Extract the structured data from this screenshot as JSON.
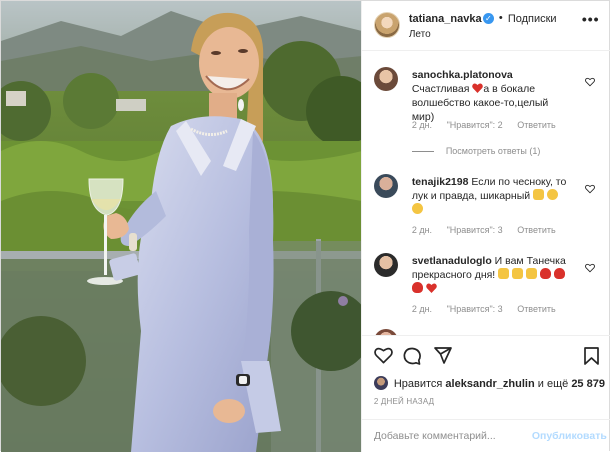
{
  "header": {
    "username": "tatiana_navka",
    "separator": "•",
    "follow_label": "Подписки",
    "location": "Лето",
    "more_label": "•••"
  },
  "comments": [
    {
      "username": "sanochka.platonova",
      "text_a": "Счастливая",
      "text_b": "а в бокале волшебство какое-то,целый мир)",
      "time": "2 дн.",
      "likes": "\"Нравится\": 2",
      "reply": "Ответить",
      "view_replies": "Посмотреть ответы (1)"
    },
    {
      "username": "tenajik2198",
      "text": "Если по чесноку, то лук и правда, шикарный",
      "time": "2 дн.",
      "likes": "\"Нравится\": 3",
      "reply": "Ответить"
    },
    {
      "username": "svetlanaduloglo",
      "text": "И вам Танечка прекрасного дня!",
      "time": "2 дн.",
      "likes": "\"Нравится\": 3",
      "reply": "Ответить"
    }
  ],
  "likes": {
    "prefix": "Нравится",
    "user": "aleksandr_zhulin",
    "middle": "и ещё",
    "count": "25 879"
  },
  "timestamp": "2 ДНЕЙ НАЗАД",
  "add_comment": {
    "placeholder": "Добавьте комментарий...",
    "publish_label": "Опубликовать"
  },
  "colors": {
    "link_blue": "#3897f0",
    "publish_disabled": "#b3dbff",
    "meta_gray": "#8e8e8e",
    "heart_red": "#ed4956"
  }
}
